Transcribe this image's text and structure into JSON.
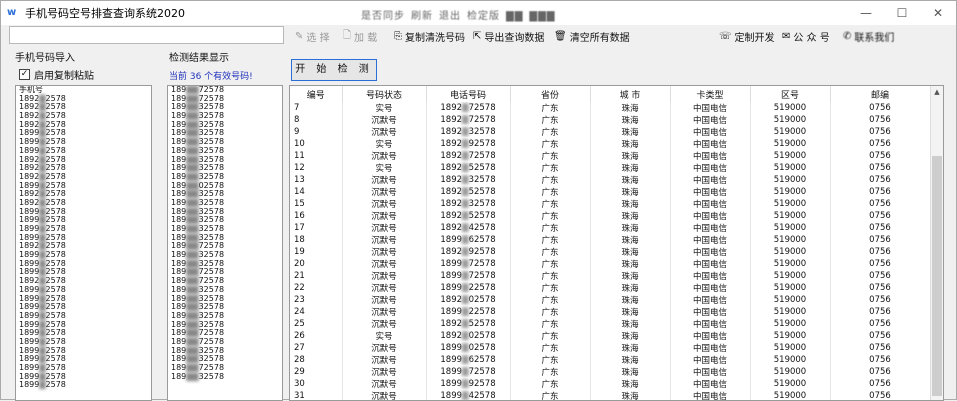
{
  "app": {
    "title": "手机号码空号排查查询系统2020",
    "icon": "w-logo-icon"
  },
  "titlebar_center": [
    "是否同步",
    "刷新",
    "退出",
    "检定版",
    "▇▇",
    "▇▇▇"
  ],
  "window_buttons": [
    "—",
    "☐",
    "✕"
  ],
  "toolbar": {
    "select": "选 择",
    "load": "加 载",
    "copy_clean": "复制清洗号码",
    "export": "导出查询数据",
    "clear": "清空所有数据",
    "custom_dev": "定制开发",
    "public_account": "公 众 号",
    "contact": "联系我们"
  },
  "left": {
    "import_label": "手机号码导入",
    "clipboard_label": "启用复制粘贴",
    "clipboard_checked": true,
    "header_line": "手机号",
    "numbers": [
      "1892",
      "1892",
      "1892",
      "1892",
      "1899",
      "1899",
      "1899",
      "1892",
      "1892",
      "1892",
      "1899",
      "1892",
      "1892",
      "1899",
      "1899",
      "1899",
      "1899",
      "1892",
      "1899",
      "1899",
      "1899",
      "1892",
      "1899",
      "1899",
      "1899",
      "1899",
      "1899",
      "1899",
      "1899",
      "1899",
      "1899",
      "1899",
      "1899",
      "1899"
    ],
    "suffixes": [
      "2578",
      "2578",
      "2578",
      "2578",
      "2578",
      "2578",
      "2578",
      "2578",
      "2578",
      "2578",
      "2578",
      "2578",
      "2578",
      "2578",
      "2578",
      "2578",
      "2578",
      "2578",
      "2578",
      "2578",
      "2578",
      "2578",
      "2578",
      "2578",
      "2578",
      "2578",
      "2578",
      "2578",
      "2578",
      "2578",
      "2578",
      "2578",
      "2578",
      "2578"
    ]
  },
  "middle": {
    "result_label": "检测结果显示",
    "count_text": "当前 36 个有效号码!",
    "numbers": [
      "189",
      "189",
      "189",
      "189",
      "189",
      "189",
      "189",
      "189",
      "189",
      "189",
      "189",
      "189",
      "189",
      "189",
      "189",
      "189",
      "189",
      "189",
      "189",
      "189",
      "189",
      "189",
      "189",
      "189",
      "189",
      "189",
      "189",
      "189",
      "189",
      "189",
      "189",
      "189",
      "189",
      "189"
    ],
    "suffixes": [
      "72578",
      "72578",
      "32578",
      "32578",
      "32578",
      "32578",
      "32578",
      "32578",
      "32578",
      "32578",
      "32578",
      "02578",
      "32578",
      "32578",
      "32578",
      "32578",
      "32578",
      "32578",
      "72578",
      "32578",
      "32578",
      "72578",
      "72578",
      "32578",
      "32578",
      "32578",
      "32578",
      "32578",
      "72578",
      "72578",
      "32578",
      "32578",
      "72578",
      "32578"
    ]
  },
  "start_button": "开 始 检 测",
  "table": {
    "headers": [
      "编号",
      "号码状态",
      "电话号码",
      "省份",
      "城 市",
      "卡类型",
      "区号",
      "邮编"
    ],
    "rows": [
      [
        "7",
        "实号",
        "1892",
        "72578",
        "广东",
        "珠海",
        "中国电信",
        "519000",
        "0756"
      ],
      [
        "8",
        "沉默号",
        "1892",
        "72578",
        "广东",
        "珠海",
        "中国电信",
        "519000",
        "0756"
      ],
      [
        "9",
        "沉默号",
        "1892",
        "32578",
        "广东",
        "珠海",
        "中国电信",
        "519000",
        "0756"
      ],
      [
        "10",
        "实号",
        "1892",
        "92578",
        "广东",
        "珠海",
        "中国电信",
        "519000",
        "0756"
      ],
      [
        "11",
        "沉默号",
        "1892",
        "72578",
        "广东",
        "珠海",
        "中国电信",
        "519000",
        "0756"
      ],
      [
        "12",
        "实号",
        "1892",
        "52578",
        "广东",
        "珠海",
        "中国电信",
        "519000",
        "0756"
      ],
      [
        "13",
        "沉默号",
        "1892",
        "32578",
        "广东",
        "珠海",
        "中国电信",
        "519000",
        "0756"
      ],
      [
        "14",
        "沉默号",
        "1892",
        "52578",
        "广东",
        "珠海",
        "中国电信",
        "519000",
        "0756"
      ],
      [
        "15",
        "沉默号",
        "1892",
        "32578",
        "广东",
        "珠海",
        "中国电信",
        "519000",
        "0756"
      ],
      [
        "16",
        "沉默号",
        "1892",
        "52578",
        "广东",
        "珠海",
        "中国电信",
        "519000",
        "0756"
      ],
      [
        "17",
        "沉默号",
        "1892",
        "42578",
        "广东",
        "珠海",
        "中国电信",
        "519000",
        "0756"
      ],
      [
        "18",
        "沉默号",
        "1899",
        "62578",
        "广东",
        "珠海",
        "中国电信",
        "519000",
        "0756"
      ],
      [
        "19",
        "沉默号",
        "1892",
        "92578",
        "广东",
        "珠海",
        "中国电信",
        "519000",
        "0756"
      ],
      [
        "20",
        "沉默号",
        "1899",
        "72578",
        "广东",
        "珠海",
        "中国电信",
        "519000",
        "0756"
      ],
      [
        "21",
        "沉默号",
        "1899",
        "72578",
        "广东",
        "珠海",
        "中国电信",
        "519000",
        "0756"
      ],
      [
        "22",
        "沉默号",
        "1899",
        "22578",
        "广东",
        "珠海",
        "中国电信",
        "519000",
        "0756"
      ],
      [
        "23",
        "沉默号",
        "1892",
        "02578",
        "广东",
        "珠海",
        "中国电信",
        "519000",
        "0756"
      ],
      [
        "24",
        "沉默号",
        "1899",
        "22578",
        "广东",
        "珠海",
        "中国电信",
        "519000",
        "0756"
      ],
      [
        "25",
        "沉默号",
        "1892",
        "52578",
        "广东",
        "珠海",
        "中国电信",
        "519000",
        "0756"
      ],
      [
        "26",
        "实号",
        "1892",
        "02578",
        "广东",
        "珠海",
        "中国电信",
        "519000",
        "0756"
      ],
      [
        "27",
        "沉默号",
        "1899",
        "02578",
        "广东",
        "珠海",
        "中国电信",
        "519000",
        "0756"
      ],
      [
        "28",
        "沉默号",
        "1899",
        "62578",
        "广东",
        "珠海",
        "中国电信",
        "519000",
        "0756"
      ],
      [
        "29",
        "沉默号",
        "1899",
        "72578",
        "广东",
        "珠海",
        "中国电信",
        "519000",
        "0756"
      ],
      [
        "30",
        "沉默号",
        "1899",
        "92578",
        "广东",
        "珠海",
        "中国电信",
        "519000",
        "0756"
      ],
      [
        "31",
        "沉默号",
        "1899",
        "42578",
        "广东",
        "珠海",
        "中国电信",
        "519000",
        "0756"
      ]
    ]
  },
  "colors": {
    "accent": "#2a6fd8",
    "count_text": "#2233bb"
  }
}
